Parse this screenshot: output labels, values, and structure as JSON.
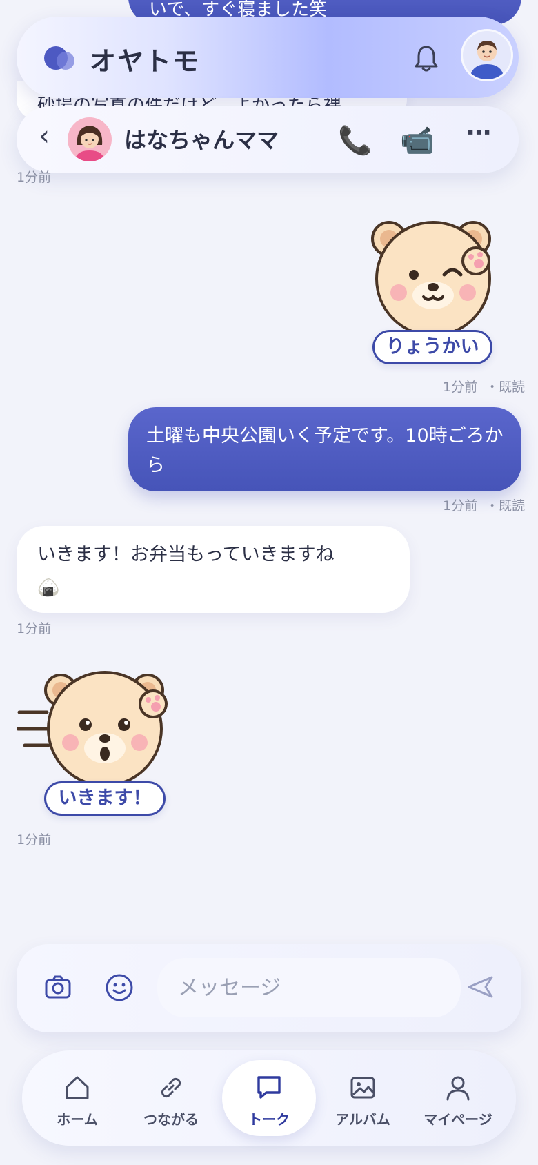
{
  "partial_messages": {
    "sent_tail": "いで、すぐ寝ました笑",
    "received_tail": "砂場の写真の件だけど、よかったら裸"
  },
  "app": {
    "brand": "オヤトモ"
  },
  "chat_header": {
    "back": "‹",
    "friend_name": "はなちゃんママ",
    "more": "⋯"
  },
  "messages": [
    {
      "type": "time",
      "text": "1分前"
    },
    {
      "type": "stamp",
      "side": "sent",
      "label": "りょうかい",
      "time": "1分前",
      "read": "・既読"
    },
    {
      "type": "text",
      "side": "sent",
      "text": "土曜も中央公園いく予定です。10時ごろから",
      "time": "1分前",
      "read": "・既読"
    },
    {
      "type": "text",
      "side": "received",
      "text": "いきます！お弁当もっていきますね",
      "emoji": "🍙",
      "time": "1分前"
    },
    {
      "type": "stamp",
      "side": "received",
      "label": "いきます！",
      "time": "1分前"
    }
  ],
  "composer": {
    "placeholder": "メッセージ"
  },
  "icons": {
    "bell": "bell-icon",
    "phone": "phone-icon",
    "video": "video-camera-icon",
    "camera": "camera-icon",
    "smile": "smile-icon",
    "send": "send-icon"
  },
  "tabs": [
    {
      "label": "ホーム",
      "icon": "home-icon"
    },
    {
      "label": "つながる",
      "icon": "link-icon"
    },
    {
      "label": "トーク",
      "icon": "chat-icon",
      "active": true
    },
    {
      "label": "アルバム",
      "icon": "album-icon"
    },
    {
      "label": "マイページ",
      "icon": "user-icon"
    }
  ],
  "colors": {
    "accent": "#4654b8",
    "background": "#f2f3fa",
    "stamp_border": "#3d4aa8"
  }
}
